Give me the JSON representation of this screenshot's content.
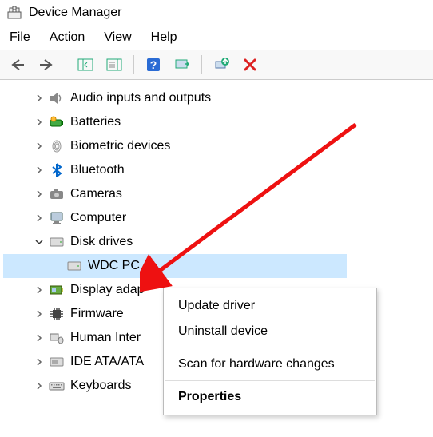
{
  "window": {
    "title": "Device Manager"
  },
  "menu": {
    "file": "File",
    "action": "Action",
    "view": "View",
    "help": "Help"
  },
  "tree": {
    "audio": "Audio inputs and outputs",
    "batteries": "Batteries",
    "biometric": "Biometric devices",
    "bluetooth": "Bluetooth",
    "cameras": "Cameras",
    "computer": "Computer",
    "disk_drives": "Disk drives",
    "wdc_device": "WDC PC",
    "display": "Display adap",
    "firmware": "Firmware",
    "hid": "Human Inter",
    "ide": "IDE ATA/ATA",
    "keyboards": "Keyboards"
  },
  "context_menu": {
    "update": "Update driver",
    "uninstall": "Uninstall device",
    "scan": "Scan for hardware changes",
    "properties": "Properties"
  }
}
